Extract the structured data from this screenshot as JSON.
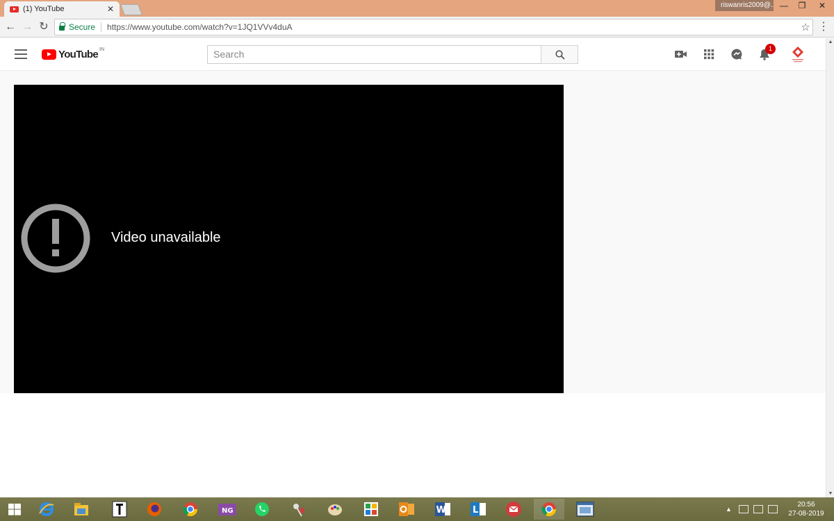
{
  "browser": {
    "tab_title": "(1) YouTube",
    "profile": "riswanris2009@...",
    "secure_label": "Secure",
    "url": "https://www.youtube.com/watch?v=1JQ1VVv4duA"
  },
  "masthead": {
    "logo_text": "YouTube",
    "region": "IN",
    "search_placeholder": "Search",
    "notification_count": "1"
  },
  "player": {
    "error_message": "Video unavailable"
  },
  "taskbar": {
    "apps": [
      "internet-explorer",
      "file-explorer",
      "text-app",
      "firefox",
      "chrome",
      "notegen",
      "whatsapp",
      "network-tool",
      "paint",
      "photos",
      "outlook",
      "word",
      "lync",
      "mail",
      "chrome-active",
      "window-app"
    ],
    "time": "20:56",
    "date": "27-08-2019"
  },
  "colors": {
    "titlebar": "#e4a57f",
    "youtube_red": "#ff0000",
    "secure_green": "#0b8043",
    "badge_red": "#d40000"
  }
}
